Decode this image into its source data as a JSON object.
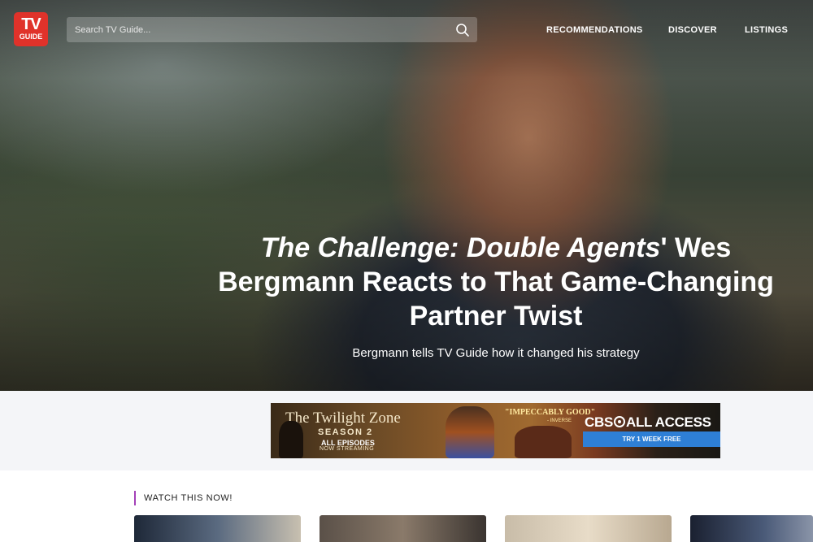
{
  "brand": {
    "logo_top": "TV",
    "logo_bottom": "GUIDE"
  },
  "search": {
    "placeholder": "Search TV Guide..."
  },
  "nav": {
    "items": [
      {
        "label": "RECOMMENDATIONS"
      },
      {
        "label": "DISCOVER"
      },
      {
        "label": "LISTINGS"
      }
    ]
  },
  "hero": {
    "title_italic": "The Challenge: Double Agents",
    "title_rest": "' Wes Bergmann Reacts to That Game-Changing Partner Twist",
    "subtitle": "Bergmann tells TV Guide how it changed his strategy"
  },
  "ad": {
    "title": "The Twilight Zone",
    "season": "SEASON 2",
    "episodes": "ALL EPISODES",
    "streaming": "NOW STREAMING",
    "quote": "\"IMPECCABLY GOOD\"",
    "quote_source": "- INVERSE",
    "network_left": "CBS",
    "network_right": "ALL ACCESS",
    "cta": "TRY 1 WEEK FREE"
  },
  "sections": {
    "watch_now": "WATCH THIS NOW!"
  },
  "colors": {
    "brand_red": "#e0322a",
    "section_accent": "#a340b8",
    "cta_blue": "#2e7fd6",
    "ad_band_bg": "#f4f5f8"
  },
  "icons": {
    "search": "search-icon",
    "cbs_eye": "cbs-eye-icon"
  }
}
